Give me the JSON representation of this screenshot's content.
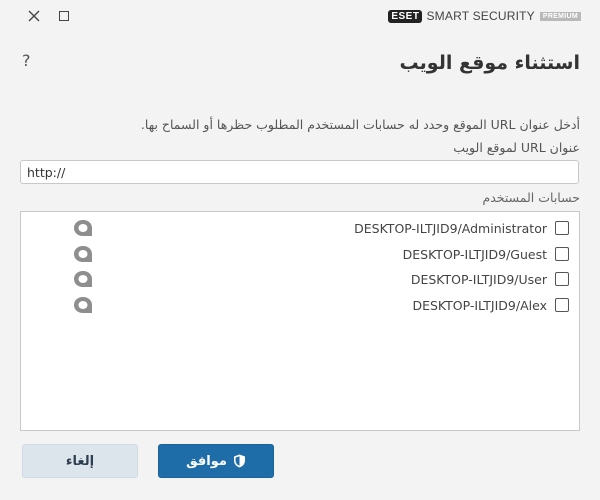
{
  "titlebar": {
    "close_icon": "close-icon",
    "maximize_icon": "maximize-icon",
    "brand": {
      "logo": "ESET",
      "product": "SMART SECURITY",
      "tier": "PREMIUM"
    }
  },
  "dialog": {
    "title": "استثناء موقع الويب",
    "help_icon": "?",
    "description": "أدخل عنوان URL الموقع وحدد له حسابات المستخدم المطلوب حظرها أو السماح بها.",
    "url_label": "عنوان URL لموقع الويب",
    "url_value": "http://",
    "users_label": "حسابات المستخدم",
    "users": [
      {
        "name": "DESKTOP-ILTJID9/Administrator",
        "checked": false
      },
      {
        "name": "DESKTOP-ILTJID9/Guest",
        "checked": false
      },
      {
        "name": "DESKTOP-ILTJID9/User",
        "checked": false
      },
      {
        "name": "DESKTOP-ILTJID9/Alex",
        "checked": false
      }
    ]
  },
  "buttons": {
    "ok_label": "موافق",
    "cancel_label": "إلغاء"
  },
  "colors": {
    "accent": "#1e6da8",
    "cancel_bg": "#dce5ec",
    "background": "#f3f3f3"
  }
}
